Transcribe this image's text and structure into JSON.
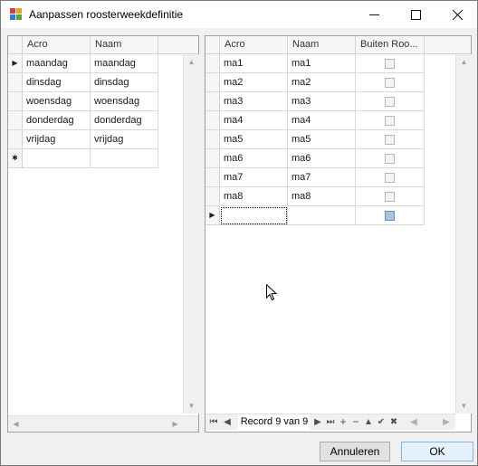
{
  "window": {
    "title": "Aanpassen roosterweekdefinitie",
    "minimize_icon": "minimize-icon",
    "maximize_icon": "maximize-icon",
    "close_icon": "close-icon"
  },
  "left_grid": {
    "columns": [
      "Acro",
      "Naam"
    ],
    "rows": [
      {
        "acro": "maandag",
        "naam": "maandag"
      },
      {
        "acro": "dinsdag",
        "naam": "dinsdag"
      },
      {
        "acro": "woensdag",
        "naam": "woensdag"
      },
      {
        "acro": "donderdag",
        "naam": "donderdag"
      },
      {
        "acro": "vrijdag",
        "naam": "vrijdag"
      }
    ],
    "current_row_marker": "▶",
    "new_row_marker": "✱"
  },
  "right_grid": {
    "columns": [
      "Acro",
      "Naam",
      "Buiten Roo..."
    ],
    "rows": [
      {
        "acro": "ma1",
        "naam": "ma1",
        "buiten": false
      },
      {
        "acro": "ma2",
        "naam": "ma2",
        "buiten": false
      },
      {
        "acro": "ma3",
        "naam": "ma3",
        "buiten": false
      },
      {
        "acro": "ma4",
        "naam": "ma4",
        "buiten": false
      },
      {
        "acro": "ma5",
        "naam": "ma5",
        "buiten": false
      },
      {
        "acro": "ma6",
        "naam": "ma6",
        "buiten": false
      },
      {
        "acro": "ma7",
        "naam": "ma7",
        "buiten": false
      },
      {
        "acro": "ma8",
        "naam": "ma8",
        "buiten": false
      }
    ],
    "current_row_marker": "▶",
    "navigator": {
      "record_text": "Record 9 van 9"
    }
  },
  "buttons": {
    "cancel": "Annuleren",
    "ok": "OK"
  },
  "colors": {
    "title_bar": "#ffffff",
    "window_bg": "#f0f0f0",
    "ok_border": "#7eb4ea"
  }
}
